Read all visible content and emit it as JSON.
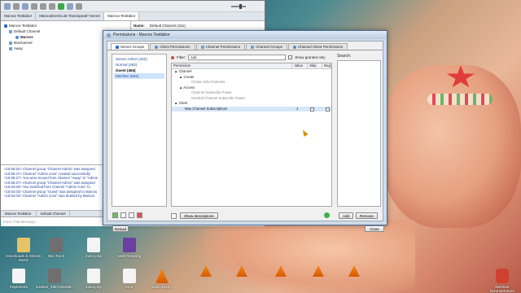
{
  "teamspeak": {
    "tabs": [
      "Marvos Testlabor",
      "MarvosEvents.de Teamspeak³ Server",
      "Marvos Testlabor"
    ],
    "tree": [
      {
        "label": "Marvos Testlabor",
        "type": "server"
      },
      {
        "label": "Default Channel",
        "type": "channel"
      },
      {
        "label": "Marvos",
        "type": "user"
      },
      {
        "label": "Botchannel",
        "type": "channel"
      },
      {
        "label": "Away",
        "type": "channel"
      }
    ],
    "info_key": "Name:",
    "info_value": "Default Channel (161)",
    "log": [
      "<16:55:52> Channel group \"Channel Admin\" was assigned",
      "<16:55:27> Channel \"Admin zone\" created successfully",
      "<16:55:27> You were moved from channel \"Away\" to \"Admin",
      "<16:55:27> Channel group \"Channel Admin\" was assigned",
      "<16:54:03> Yao switched from channel \"Admin zone\" to",
      "<16:54:03> Channel group \"Guest\" was assigned to Marvos",
      "<16:54:03> Channel \"Admin zone\" was deleted by Marvos"
    ],
    "chat_tabs": [
      "Marvos Testlabor",
      "Default Channel"
    ],
    "chat_placeholder": "Enter Chat Message..."
  },
  "permissions": {
    "title": "Permissions - Marvos Testlabor",
    "tabs": [
      "Server Groups",
      "Client Permissions",
      "Channel Permissions",
      "Channel Groups",
      "Channel Client Permissions"
    ],
    "groups": [
      {
        "label": "Server Admin (462)",
        "style": "normal"
      },
      {
        "label": "Normal (463)",
        "style": "normal"
      },
      {
        "label": "Guest (464)",
        "style": "bold"
      },
      {
        "label": "Member (653)",
        "style": "selected"
      }
    ],
    "filter_label": "Filter:",
    "filter_value": "sub",
    "show_granted": "Show granted only",
    "search_label": "Search:",
    "columns": {
      "permission": "Permission",
      "value": "Value",
      "skip": "Skip",
      "negate": "Neg"
    },
    "rows": [
      {
        "label": "Channel",
        "indent": 1,
        "style": "normal",
        "value": ""
      },
      {
        "label": "Create",
        "indent": 2,
        "style": "normal",
        "value": ""
      },
      {
        "label": "Create Sub-Channels",
        "indent": 3,
        "style": "dim",
        "value": ""
      },
      {
        "label": "Access",
        "indent": 2,
        "style": "normal",
        "value": ""
      },
      {
        "label": "Channel Subscribe Power",
        "indent": 3,
        "style": "dim",
        "value": ""
      },
      {
        "label": "Needed Channel Subscribe Power",
        "indent": 3,
        "style": "dim",
        "value": ""
      },
      {
        "label": "Client",
        "indent": 1,
        "style": "normal",
        "value": ""
      },
      {
        "label": "Max Channel Subscriptions",
        "indent": 2,
        "style": "selected",
        "value": "-1"
      }
    ],
    "show_descriptions": "Show descriptions",
    "add": "Add",
    "remove": "Remove",
    "reload": "Reload",
    "close": "Close"
  },
  "desktop_icons": [
    {
      "label": "Downloads & Stream Music",
      "kind": "folder"
    },
    {
      "label": "War Rock",
      "kind": "mp3"
    },
    {
      "label": "index.php",
      "kind": "file"
    },
    {
      "label": "MultiTexturing",
      "kind": "music"
    },
    {
      "label": "Papierkorb",
      "kind": "file"
    },
    {
      "label": "644652_4867335288...",
      "kind": "mp3"
    },
    {
      "label": "index.php",
      "kind": "file"
    },
    {
      "label": "error",
      "kind": "file"
    },
    {
      "label": "video 2012...",
      "kind": "vlc"
    },
    {
      "label": "Rechner herunterfahren",
      "kind": "power"
    }
  ]
}
